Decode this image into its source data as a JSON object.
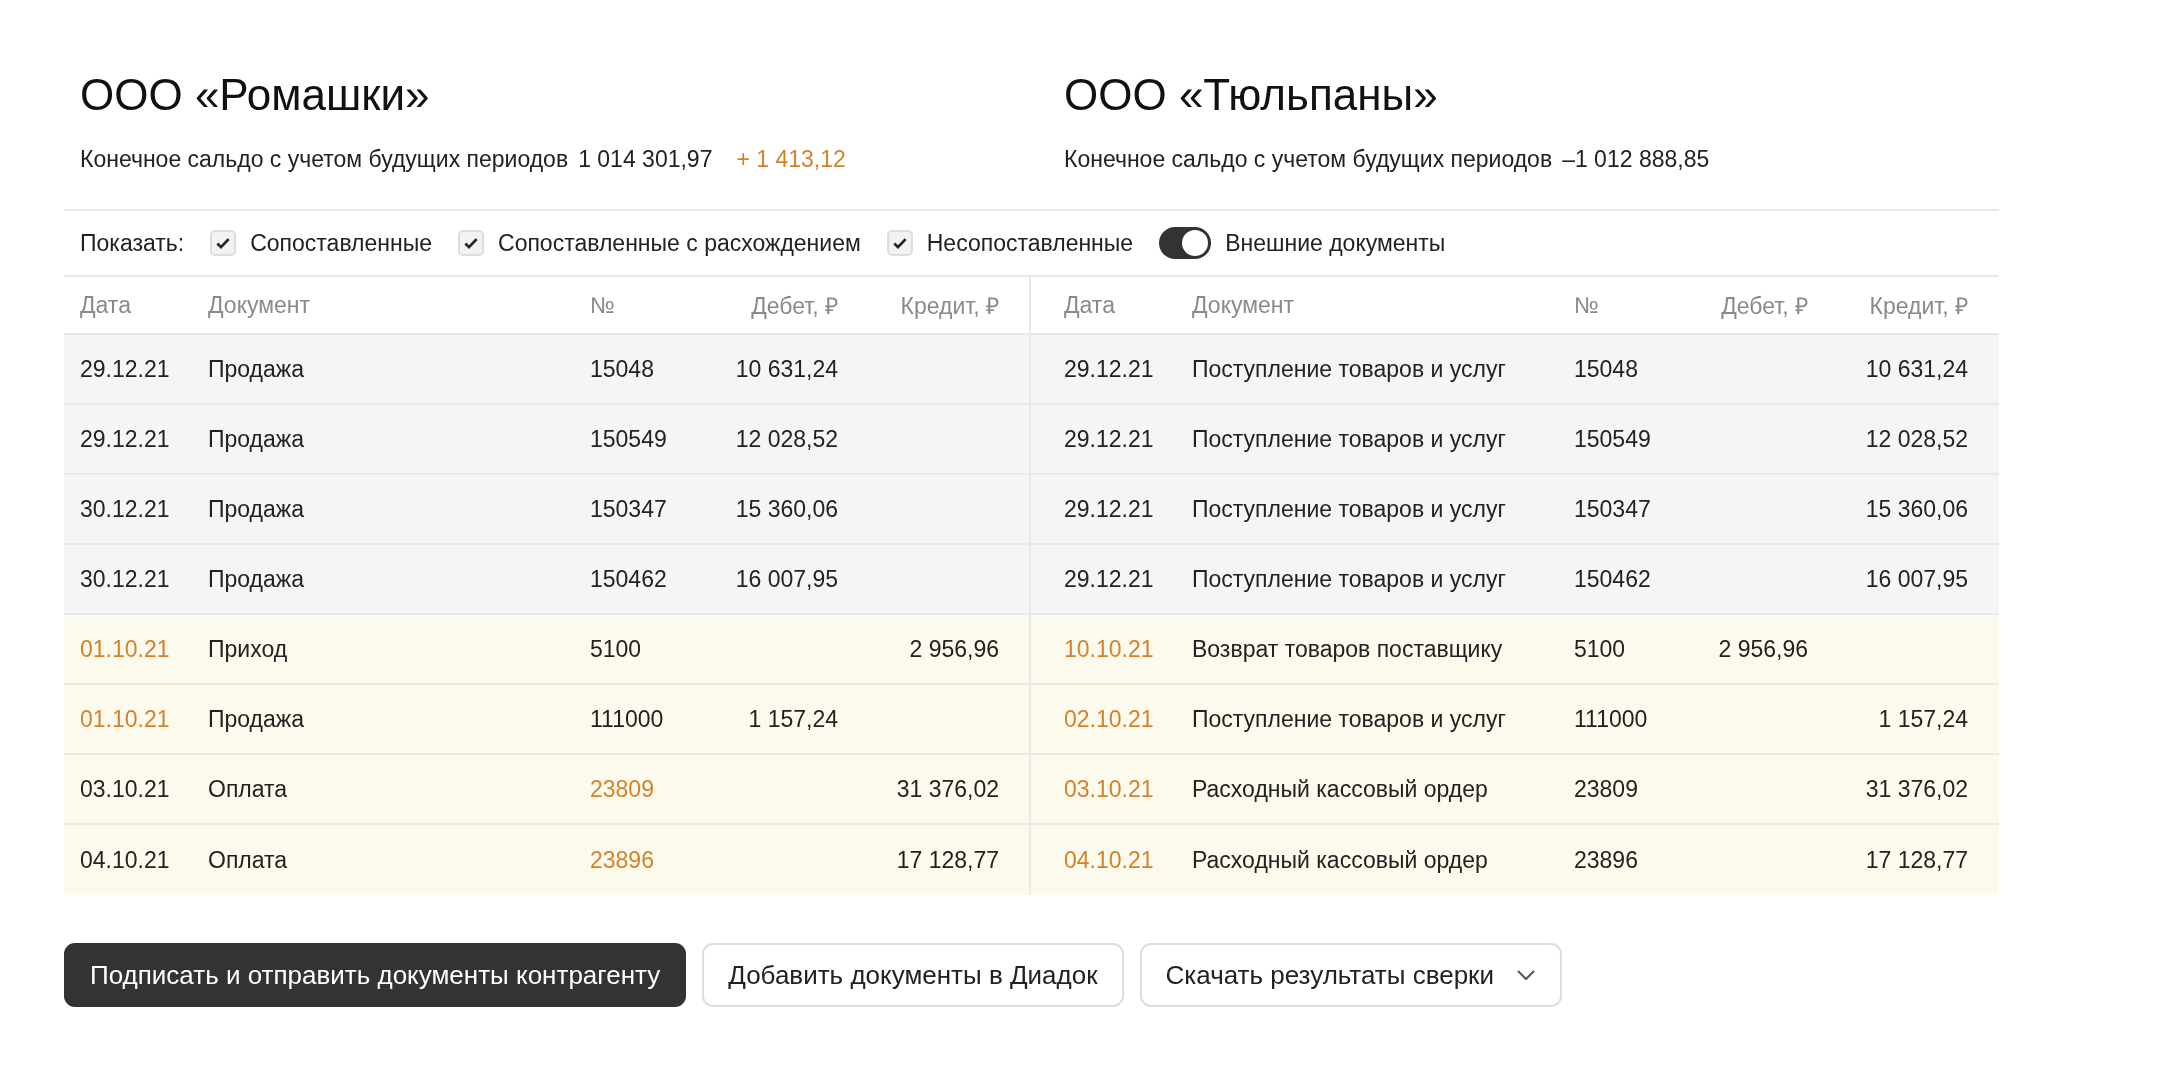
{
  "parties": [
    {
      "name": "ООО «Ромашки»",
      "balance_label": "Конечное сальдо с учетом будущих периодов",
      "balance": "1 014 301,97",
      "difference": "+ 1 413,12"
    },
    {
      "name": "ООО «Тюльпаны»",
      "balance_label": "Конечное сальдо с учетом будущих периодов",
      "balance": "–1 012 888,85"
    }
  ],
  "filters": {
    "label": "Показать:",
    "items": [
      {
        "kind": "checkbox",
        "label": "Сопоставленные",
        "checked": true
      },
      {
        "kind": "checkbox",
        "label": "Сопоставленные с расхождением",
        "checked": true
      },
      {
        "kind": "checkbox",
        "label": "Несопоставленные",
        "checked": true
      },
      {
        "kind": "toggle",
        "label": "Внешние документы",
        "checked": true
      }
    ]
  },
  "table": {
    "columns": [
      "Дата",
      "Документ",
      "№",
      "Дебет, ₽",
      "Кредит, ₽"
    ],
    "right_columns": [
      "Дата",
      "Документ",
      "№",
      "Дебет, ₽",
      "Кредит, ₽"
    ],
    "rows": [
      {
        "kind": "matched",
        "left": {
          "date": "29.12.21",
          "document": "Продажа",
          "number": "15048",
          "debit": "10 631,24"
        },
        "right": {
          "date": "29.12.21",
          "document": "Поступление товаров и услуг",
          "number": "15048",
          "credit": "10 631,24"
        }
      },
      {
        "kind": "matched",
        "left": {
          "date": "29.12.21",
          "document": "Продажа",
          "number": "150549",
          "debit": "12 028,52"
        },
        "right": {
          "date": "29.12.21",
          "document": "Поступление товаров и услуг",
          "number": "150549",
          "credit": "12 028,52"
        }
      },
      {
        "kind": "matched",
        "left": {
          "date": "30.12.21",
          "document": "Продажа",
          "number": "150347",
          "debit": "15 360,06"
        },
        "right": {
          "date": "29.12.21",
          "document": "Поступление товаров и услуг",
          "number": "150347",
          "credit": "15 360,06"
        }
      },
      {
        "kind": "matched",
        "left": {
          "date": "30.12.21",
          "document": "Продажа",
          "number": "150462",
          "debit": "16 007,95"
        },
        "right": {
          "date": "29.12.21",
          "document": "Поступление товаров и услуг",
          "number": "150462",
          "credit": "16 007,95"
        }
      },
      {
        "kind": "discrepancy",
        "left": {
          "date": "01.10.21",
          "date_differs": true,
          "document": "Приход",
          "number": "5100",
          "credit": "2 956,96"
        },
        "right": {
          "date": "10.10.21",
          "date_differs": true,
          "document": "Возврат товаров поставщику",
          "number": "5100",
          "debit": "2 956,96"
        }
      },
      {
        "kind": "discrepancy",
        "left": {
          "date": "01.10.21",
          "date_differs": true,
          "document": "Продажа",
          "number": "111000",
          "debit": "1 157,24"
        },
        "right": {
          "date": "02.10.21",
          "date_differs": true,
          "document": "Поступление товаров и услуг",
          "number": "111000",
          "credit": "1 157,24"
        }
      },
      {
        "kind": "discrepancy",
        "left": {
          "date": "03.10.21",
          "document": "Оплата",
          "number": "23809",
          "number_differs": true,
          "credit": "31 376,02"
        },
        "right": {
          "date": "03.10.21",
          "date_differs": true,
          "document": "Расходный кассовый ордер",
          "number": "23809",
          "credit": "31 376,02"
        }
      },
      {
        "kind": "discrepancy",
        "left": {
          "date": "04.10.21",
          "document": "Оплата",
          "number": "23896",
          "number_differs": true,
          "credit": "17 128,77"
        },
        "right": {
          "date": "04.10.21",
          "date_differs": true,
          "document": "Расходный кассовый ордер",
          "number": "23896",
          "credit": "17 128,77"
        }
      }
    ]
  },
  "actions": [
    {
      "kind": "primary",
      "label": "Подписать и отправить документы контрагенту"
    },
    {
      "kind": "secondary",
      "label": "Добавить документы в Диадок"
    },
    {
      "kind": "dropdown",
      "label": "Скачать результаты сверки"
    }
  ]
}
